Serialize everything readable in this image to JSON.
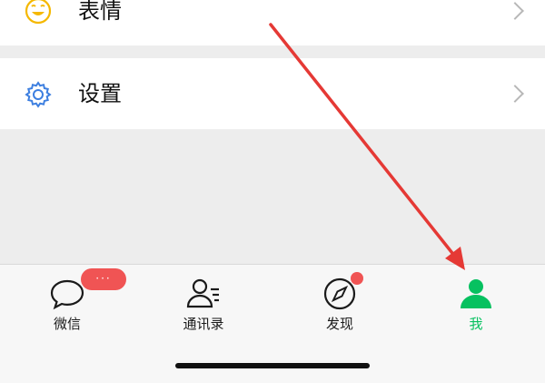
{
  "menu": {
    "items": [
      {
        "label": "表情",
        "icon": "smiley-icon"
      },
      {
        "label": "设置",
        "icon": "gear-icon"
      }
    ]
  },
  "tabbar": {
    "tabs": [
      {
        "label": "微信",
        "icon": "chat-bubble-icon",
        "badge": "···"
      },
      {
        "label": "通讯录",
        "icon": "contacts-icon"
      },
      {
        "label": "发现",
        "icon": "compass-icon"
      },
      {
        "label": "我",
        "icon": "person-icon"
      }
    ],
    "active_color": "#07c160",
    "badge_color": "#f05454"
  },
  "annotation": {
    "arrow_color": "#e53935"
  }
}
